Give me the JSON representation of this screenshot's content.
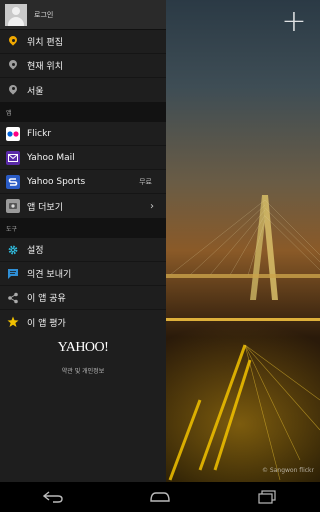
{
  "profile": {
    "label": "로그인"
  },
  "location_items": [
    {
      "label": "위치 편집",
      "icon": "location-pin-icon",
      "color": "#f0a800"
    },
    {
      "label": "현재 위치",
      "icon": "location-pin-icon",
      "color": "#9e9e9e"
    },
    {
      "label": "서울",
      "icon": "location-pin-icon",
      "color": "#9e9e9e"
    }
  ],
  "apps_section": {
    "label": "앱"
  },
  "apps": [
    {
      "label": "Flickr",
      "icon": "flickr-icon",
      "right": ""
    },
    {
      "label": "Yahoo Mail",
      "icon": "yahoo-mail-icon",
      "right": ""
    },
    {
      "label": "Yahoo Sports",
      "icon": "yahoo-sports-icon",
      "right": "무료"
    },
    {
      "label": "앱 더보기",
      "icon": "more-apps-icon",
      "right": ""
    }
  ],
  "tools_section": {
    "label": "도구"
  },
  "tools": [
    {
      "label": "설정",
      "icon": "gear-icon",
      "color": "#2fb5d6"
    },
    {
      "label": "의견 보내기",
      "icon": "feedback-icon",
      "color": "#2f8fd6"
    },
    {
      "label": "이 앱 공유",
      "icon": "share-icon",
      "color": "#aaaaaa"
    },
    {
      "label": "이 앱 평가",
      "icon": "star-icon",
      "color": "#f0c000"
    }
  ],
  "footer": {
    "logo": "YAHOO!",
    "terms": "약관 및 개인정보"
  },
  "background": {
    "credit": "© Sangwon flickr"
  },
  "colors": {
    "drawer_bg": "#1e1e1e",
    "section_bg": "#121212",
    "accent_orange": "#f0a800"
  }
}
